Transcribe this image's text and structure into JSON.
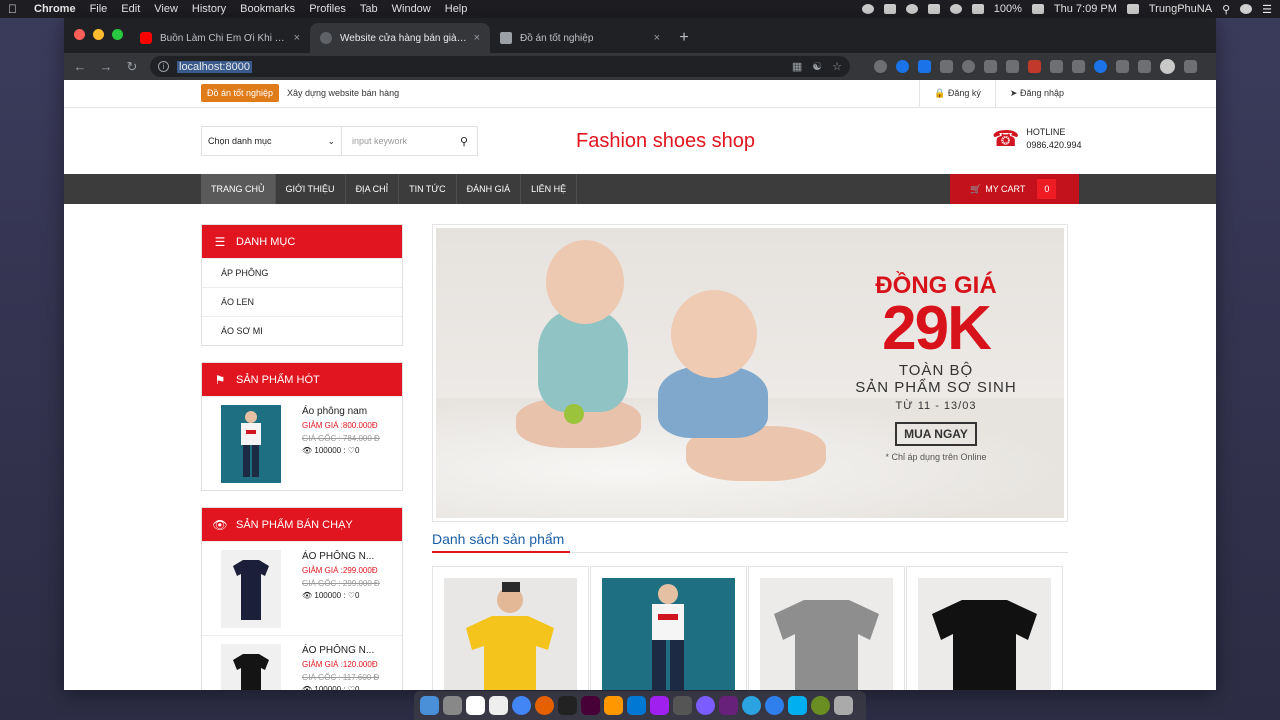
{
  "menubar": {
    "app": "Chrome",
    "items": [
      "File",
      "Edit",
      "View",
      "History",
      "Bookmarks",
      "Profiles",
      "Tab",
      "Window",
      "Help"
    ],
    "battery": "100%",
    "clock": "Thu 7:09 PM",
    "user": "TrungPhuNA"
  },
  "browser": {
    "tabs": [
      {
        "title": "Buồn Làm Chi Em Ơi Khi Tình Yêu",
        "icon": "youtube-icon"
      },
      {
        "title": "Website cửa hàng bán giày online",
        "icon": "globe-icon"
      },
      {
        "title": "Đồ án tốt nghiệp",
        "icon": "document-icon"
      }
    ],
    "new_tab": "+",
    "close_glyph": "×",
    "url": "localhost:8000"
  },
  "site": {
    "topbar": {
      "badge": "Đồ án tốt nghiệp",
      "slogan": "Xây dựng website bán hàng",
      "register": "Đăng ký",
      "login": "Đăng nhập"
    },
    "header": {
      "category_select": "Chọn danh mục",
      "search_placeholder": "input keywork",
      "brand": "Fashion shoes shop",
      "hotline_label": "HOTLINE",
      "hotline_number": "0986.420.994"
    },
    "nav": {
      "items": [
        "TRANG CHỦ",
        "GIỚI THIỆU",
        "ĐỊA CHỈ",
        "TIN TỨC",
        "ĐÁNH GIÁ",
        "LIÊN HỆ"
      ],
      "cart_label": "MY CART",
      "cart_count": "0"
    },
    "sidebar": {
      "category_title": "DANH MỤC",
      "categories": [
        "ÁP PHÔNG",
        "ÁO LEN",
        "ÁO SƠ MI"
      ],
      "hot_title": "SẢN PHẨM HÓT",
      "hot_products": [
        {
          "name": "Áo phông nam",
          "sale": "GIẢM GIÁ :800.000Đ",
          "original": "GIÁ GỐC : 784.000 Đ",
          "views": "100000",
          "likes": "0"
        }
      ],
      "best_title": "SẢN PHẨM BÁN CHẠY",
      "best_products": [
        {
          "name": "ÁO PHÔNG N...",
          "sale": "GIẢM GIÁ :299.000Đ",
          "original": "GIÁ GỐC : 299.000 Đ",
          "views": "100000",
          "likes": "0"
        },
        {
          "name": "ÁO PHÔNG N...",
          "sale": "GIẢM GIÁ :120.000Đ",
          "original": "GIÁ GỐC : 117.600 Đ",
          "views": "100000",
          "likes": "0"
        }
      ]
    },
    "banner": {
      "line1": "ĐỒNG GIÁ",
      "line2": "29K",
      "line3": "TOÀN BỘ",
      "line4": "SẢN PHẨM SƠ SINH",
      "line5": "TỪ 11 - 13/03",
      "button": "MUA NGAY",
      "note": "* Chỉ áp dụng trên Online"
    },
    "products_title": "Danh sách sản phẩm",
    "colors": {
      "accent": "#e0151f",
      "nav": "#3c3c3c",
      "link": "#1a5fa8"
    }
  }
}
